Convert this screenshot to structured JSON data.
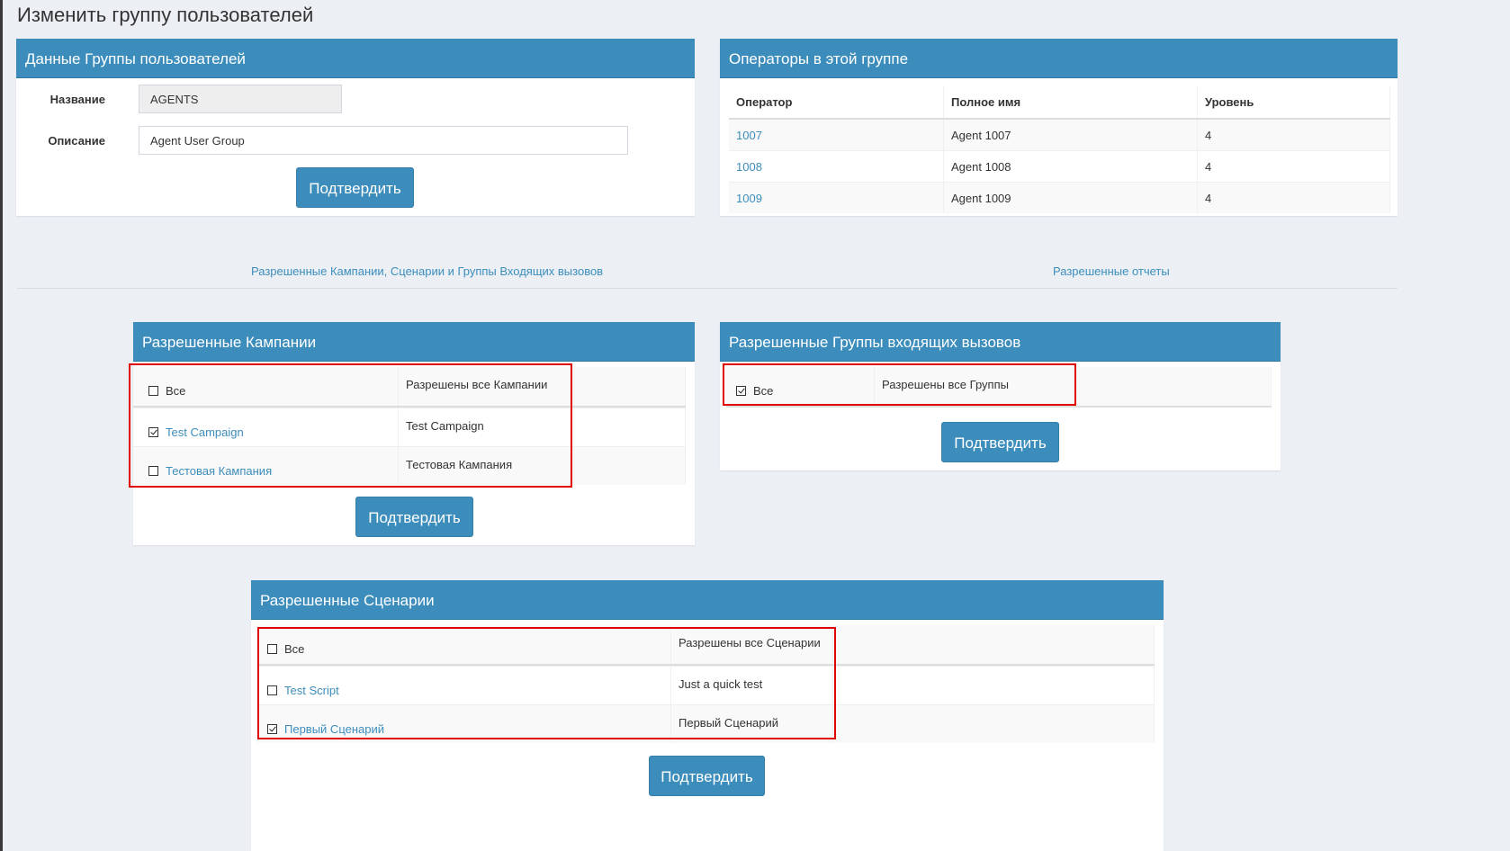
{
  "page": {
    "title": "Изменить группу пользователей"
  },
  "group_panel": {
    "header": "Данные Группы пользователей",
    "name_label": "Название",
    "name_value": "AGENTS",
    "description_label": "Описание",
    "description_value": "Agent User Group",
    "submit_label": "Подтвердить"
  },
  "operators_panel": {
    "header": "Операторы в этой группе",
    "columns": [
      "Оператор",
      "Полное имя",
      "Уровень"
    ],
    "rows": [
      {
        "operator": "1007",
        "full_name": "Agent 1007",
        "level": "4"
      },
      {
        "operator": "1008",
        "full_name": "Agent 1008",
        "level": "4"
      },
      {
        "operator": "1009",
        "full_name": "Agent 1009",
        "level": "4"
      }
    ]
  },
  "tabs": {
    "campaigns_scripts_ingroups": "Разрешенные Кампании, Сценарии и Группы Входящих вызовов",
    "reports": "Разрешенные отчеты"
  },
  "campaigns_panel": {
    "header": "Разрешенные Кампании",
    "rows": [
      {
        "label": "Все",
        "description": "Разрешены все Кампании",
        "checked": false,
        "is_link": false
      },
      {
        "label": "Test Campaign",
        "description": "Test Campaign",
        "checked": true,
        "is_link": true
      },
      {
        "label": "Тестовая Кампания",
        "description": "Тестовая Кампания",
        "checked": false,
        "is_link": true
      }
    ],
    "submit_label": "Подтвердить"
  },
  "ingroups_panel": {
    "header": "Разрешенные Группы входящих вызовов",
    "rows": [
      {
        "label": "Все",
        "description": "Разрешены все Группы",
        "checked": true,
        "is_link": false
      }
    ],
    "submit_label": "Подтвердить"
  },
  "scripts_panel": {
    "header": "Разрешенные Сценарии",
    "rows": [
      {
        "label": "Все",
        "description": "Разрешены все Сценарии",
        "checked": false,
        "is_link": false
      },
      {
        "label": "Test Script",
        "description": "Just a quick test",
        "checked": false,
        "is_link": true
      },
      {
        "label": "Первый Сценарий",
        "description": "Первый Сценарий",
        "checked": true,
        "is_link": true
      }
    ],
    "submit_label": "Подтвердить"
  },
  "colors": {
    "accent": "#3c8dbc",
    "highlight": "#e00000",
    "background": "#ecf0f5"
  }
}
